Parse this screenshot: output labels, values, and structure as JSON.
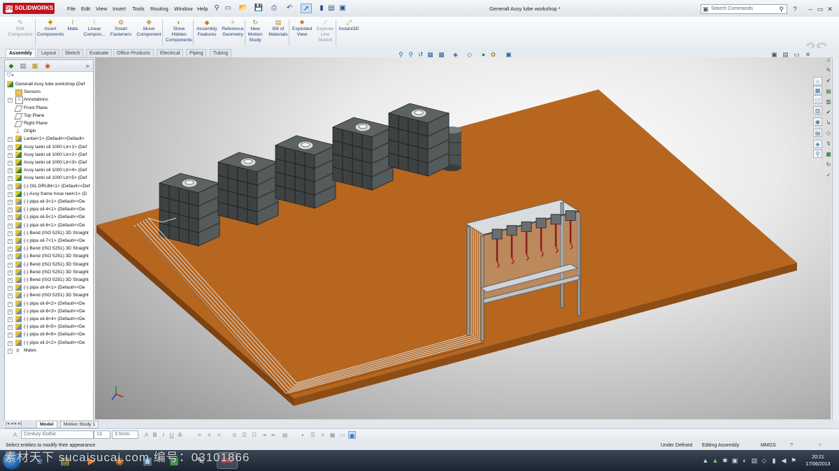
{
  "app": {
    "logo": "SOLIDWORKS",
    "document_title": "Generall Assy lube workshop *"
  },
  "menu": [
    "File",
    "Edit",
    "View",
    "Insert",
    "Tools",
    "Routing",
    "Window",
    "Help"
  ],
  "search": {
    "placeholder": "Search Commands"
  },
  "commands": [
    {
      "label": "Edit\nComponent",
      "icon": "edit-component-icon",
      "enabled": false
    },
    {
      "label": "Insert\nComponents",
      "icon": "insert-components-icon",
      "enabled": true
    },
    {
      "label": "Mate",
      "icon": "mate-icon",
      "enabled": true
    },
    {
      "label": "Linear\nCompon...",
      "icon": "linear-pattern-icon",
      "enabled": true
    },
    {
      "label": "Smart\nFasteners",
      "icon": "smart-fasteners-icon",
      "enabled": true
    },
    {
      "label": "Move\nComponent",
      "icon": "move-component-icon",
      "enabled": true
    },
    {
      "label": "Show\nHidden\nComponents",
      "icon": "show-hidden-icon",
      "enabled": true
    },
    {
      "label": "Assembly\nFeatures",
      "icon": "assembly-features-icon",
      "enabled": true
    },
    {
      "label": "Reference\nGeometry",
      "icon": "reference-geometry-icon",
      "enabled": true
    },
    {
      "label": "New\nMotion\nStudy",
      "icon": "motion-study-icon",
      "enabled": true
    },
    {
      "label": "Bill of\nMaterials",
      "icon": "bom-icon",
      "enabled": true
    },
    {
      "label": "Exploded\nView",
      "icon": "exploded-view-icon",
      "enabled": true
    },
    {
      "label": "Explode\nLine\nSketch",
      "icon": "explode-line-icon",
      "enabled": false
    },
    {
      "label": "Instant3D",
      "icon": "instant3d-icon",
      "enabled": true
    }
  ],
  "tabs": [
    "Assembly",
    "Layout",
    "Sketch",
    "Evaluate",
    "Office Products",
    "Electrical",
    "Piping",
    "Tubing"
  ],
  "tree": [
    {
      "label": "Generall Assy lube workshop  (Def",
      "icon": "assembly",
      "expand": false
    },
    {
      "label": "Sensors",
      "icon": "folder",
      "expand": false
    },
    {
      "label": "Annotations",
      "icon": "annot",
      "expand": true
    },
    {
      "label": "Front Plane",
      "icon": "plane",
      "expand": false
    },
    {
      "label": "Top Plane",
      "icon": "plane",
      "expand": false
    },
    {
      "label": "Right Plane",
      "icon": "plane",
      "expand": false
    },
    {
      "label": "Origin",
      "icon": "origin",
      "expand": false
    },
    {
      "label": "Lantai<1> (Default<<Default>",
      "icon": "part",
      "expand": true
    },
    {
      "label": "Assy tanki oil 1000 Ltr<1> (Def",
      "icon": "assembly",
      "expand": true
    },
    {
      "label": "Assy tanki oil 1000 Ltr<2> (Def",
      "icon": "assembly",
      "expand": true
    },
    {
      "label": "Assy tanki oil 1000 Ltr<3> (Def",
      "icon": "assembly",
      "expand": true
    },
    {
      "label": "Assy tanki oil 1000 Ltr<4> (Def",
      "icon": "assembly",
      "expand": true
    },
    {
      "label": "Assy tanki oil 1000 Ltr<5> (Def",
      "icon": "assembly",
      "expand": true
    },
    {
      "label": "(-) OIL DRUM<1> (Default<<Def",
      "icon": "part",
      "expand": true
    },
    {
      "label": "(-) Assy frame hose reel<1> (D",
      "icon": "assembly",
      "expand": true
    },
    {
      "label": "(-) pipa oil-3<1> (Default<<De",
      "icon": "part",
      "expand": true
    },
    {
      "label": "(-) pipa oil-4<1> (Default<<De",
      "icon": "part",
      "expand": true
    },
    {
      "label": "(-) pipa oil-5<1> (Default<<De",
      "icon": "part",
      "expand": true
    },
    {
      "label": "(-) pipa oil-6<1> (Default<<De",
      "icon": "part",
      "expand": true
    },
    {
      "label": "(-) Bend (ISO 5251) 3D Straight",
      "icon": "part",
      "expand": true
    },
    {
      "label": "(-) pipa oil-7<1> (Default<<De",
      "icon": "part",
      "expand": true
    },
    {
      "label": "(-) Bend (ISO 5251) 3D Straight",
      "icon": "part",
      "expand": true
    },
    {
      "label": "(-) Bend (ISO 5251) 3D Straight",
      "icon": "part",
      "expand": true
    },
    {
      "label": "(-) Bend (ISO 5251) 3D Straight",
      "icon": "part",
      "expand": true
    },
    {
      "label": "(-) Bend (ISO 5251) 3D Straight",
      "icon": "part",
      "expand": true
    },
    {
      "label": "(-) Bend (ISO 5251) 3D Straight",
      "icon": "part",
      "expand": true
    },
    {
      "label": "(-) pipa oil-8<1> (Default<<De",
      "icon": "part",
      "expand": true
    },
    {
      "label": "(-) Bend (ISO 5251) 3D Straight",
      "icon": "part",
      "expand": true
    },
    {
      "label": "(-) pipa oil-8<2> (Default<<De",
      "icon": "part",
      "expand": true
    },
    {
      "label": "(-) pipa oil-8<3> (Default<<De",
      "icon": "part",
      "expand": true
    },
    {
      "label": "(-) pipa oil-8<4> (Default<<De",
      "icon": "part",
      "expand": true
    },
    {
      "label": "(-) pipa oil-8<5> (Default<<De",
      "icon": "part",
      "expand": true
    },
    {
      "label": "(-) pipa oil-8<6> (Default<<De",
      "icon": "part",
      "expand": true
    },
    {
      "label": "(-) pipa oil-2<2> (Default<<De",
      "icon": "part",
      "expand": true
    },
    {
      "label": "Mates",
      "icon": "mates",
      "expand": true
    }
  ],
  "bottom_tabs": [
    "Model",
    "Motion Study 1"
  ],
  "format": {
    "font": "Century Gothic",
    "size": "13",
    "height": "3.5mm"
  },
  "status": {
    "message": "Select entities to modify their appearance",
    "definition": "Under Defined",
    "mode": "Editing Assembly",
    "units": "MMGS"
  },
  "clock": {
    "time": "20:21",
    "date": "17/06/2013"
  },
  "watermark": "素材天下 sucaisucai.com  编号：03101866",
  "colors": {
    "floor": "#b8641c",
    "floor_edge": "#7a3d0c",
    "tank": "#3f4242",
    "accent": "#c0141e"
  }
}
